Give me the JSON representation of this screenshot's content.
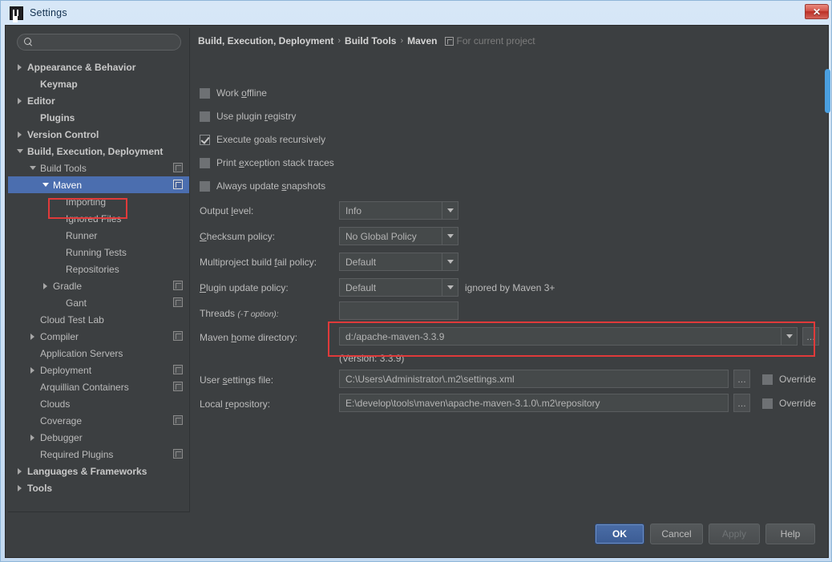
{
  "window": {
    "title": "Settings",
    "logo_icon": "intellij-idea-logo",
    "close_icon": "close-icon",
    "close_label": "✕"
  },
  "sidebar": {
    "search": {
      "value": "",
      "placeholder": "",
      "icon": "search-icon"
    },
    "items": [
      {
        "label": "Appearance & Behavior",
        "indent": 0,
        "arrow": "right",
        "bold": true,
        "selected": false,
        "module_icon": false
      },
      {
        "label": "Keymap",
        "indent": 1,
        "arrow": "none",
        "bold": true,
        "selected": false,
        "module_icon": false
      },
      {
        "label": "Editor",
        "indent": 0,
        "arrow": "right",
        "bold": true,
        "selected": false,
        "module_icon": false
      },
      {
        "label": "Plugins",
        "indent": 1,
        "arrow": "none",
        "bold": true,
        "selected": false,
        "module_icon": false
      },
      {
        "label": "Version Control",
        "indent": 0,
        "arrow": "right",
        "bold": true,
        "selected": false,
        "module_icon": false
      },
      {
        "label": "Build, Execution, Deployment",
        "indent": 0,
        "arrow": "down",
        "bold": true,
        "selected": false,
        "module_icon": false
      },
      {
        "label": "Build Tools",
        "indent": 1,
        "arrow": "down",
        "bold": false,
        "selected": false,
        "module_icon": true
      },
      {
        "label": "Maven",
        "indent": 2,
        "arrow": "down",
        "bold": false,
        "selected": true,
        "module_icon": true
      },
      {
        "label": "Importing",
        "indent": 3,
        "arrow": "none",
        "bold": false,
        "selected": false,
        "module_icon": false
      },
      {
        "label": "Ignored Files",
        "indent": 3,
        "arrow": "none",
        "bold": false,
        "selected": false,
        "module_icon": false
      },
      {
        "label": "Runner",
        "indent": 3,
        "arrow": "none",
        "bold": false,
        "selected": false,
        "module_icon": false
      },
      {
        "label": "Running Tests",
        "indent": 3,
        "arrow": "none",
        "bold": false,
        "selected": false,
        "module_icon": false
      },
      {
        "label": "Repositories",
        "indent": 3,
        "arrow": "none",
        "bold": false,
        "selected": false,
        "module_icon": false
      },
      {
        "label": "Gradle",
        "indent": 2,
        "arrow": "right",
        "bold": false,
        "selected": false,
        "module_icon": true
      },
      {
        "label": "Gant",
        "indent": 3,
        "arrow": "none",
        "bold": false,
        "selected": false,
        "module_icon": true
      },
      {
        "label": "Cloud Test Lab",
        "indent": 1,
        "arrow": "none",
        "bold": false,
        "selected": false,
        "module_icon": false
      },
      {
        "label": "Compiler",
        "indent": 1,
        "arrow": "right",
        "bold": false,
        "selected": false,
        "module_icon": true
      },
      {
        "label": "Application Servers",
        "indent": 1,
        "arrow": "none",
        "bold": false,
        "selected": false,
        "module_icon": false
      },
      {
        "label": "Deployment",
        "indent": 1,
        "arrow": "right",
        "bold": false,
        "selected": false,
        "module_icon": true
      },
      {
        "label": "Arquillian Containers",
        "indent": 1,
        "arrow": "none",
        "bold": false,
        "selected": false,
        "module_icon": true
      },
      {
        "label": "Clouds",
        "indent": 1,
        "arrow": "none",
        "bold": false,
        "selected": false,
        "module_icon": false
      },
      {
        "label": "Coverage",
        "indent": 1,
        "arrow": "none",
        "bold": false,
        "selected": false,
        "module_icon": true
      },
      {
        "label": "Debugger",
        "indent": 1,
        "arrow": "right",
        "bold": false,
        "selected": false,
        "module_icon": false
      },
      {
        "label": "Required Plugins",
        "indent": 1,
        "arrow": "none",
        "bold": false,
        "selected": false,
        "module_icon": true
      },
      {
        "label": "Languages & Frameworks",
        "indent": 0,
        "arrow": "right",
        "bold": true,
        "selected": false,
        "module_icon": false
      },
      {
        "label": "Tools",
        "indent": 0,
        "arrow": "right",
        "bold": true,
        "selected": false,
        "module_icon": false
      }
    ]
  },
  "breadcrumb": {
    "part1": "Build, Execution, Deployment",
    "part2": "Build Tools",
    "part3": "Maven",
    "separator": "›",
    "scope_icon": "module-scope-icon",
    "scope_label": "For current project"
  },
  "checkboxes": [
    {
      "label_pre": "Work ",
      "mnemonic": "o",
      "label_post": "ffline",
      "checked": false
    },
    {
      "label_pre": "Use plugin ",
      "mnemonic": "r",
      "label_post": "egistry",
      "checked": false
    },
    {
      "label_pre": "Execute ",
      "mnemonic": "g",
      "label_post": "oals recursively",
      "checked": true
    },
    {
      "label_pre": "Print ",
      "mnemonic": "e",
      "label_post": "xception stack traces",
      "checked": false
    },
    {
      "label_pre": "Always update ",
      "mnemonic": "s",
      "label_post": "napshots",
      "checked": false
    }
  ],
  "fields": {
    "output_level": {
      "label_pre": "Output ",
      "mnemonic": "l",
      "label_post": "evel:",
      "value": "Info"
    },
    "checksum_policy": {
      "label_pre": "",
      "mnemonic": "C",
      "label_post": "hecksum policy:",
      "value": "No Global Policy"
    },
    "multiproject": {
      "label_pre": "Multiproject build ",
      "mnemonic": "f",
      "label_post": "ail policy:",
      "value": "Default"
    },
    "plugin_update": {
      "label_pre": "",
      "mnemonic": "P",
      "label_post": "lugin update policy:",
      "value": "Default",
      "note": "ignored by Maven 3+"
    },
    "threads": {
      "label": "Threads",
      "hint": "(-T option):",
      "value": ""
    },
    "maven_home": {
      "label_pre": "Maven ",
      "mnemonic": "h",
      "label_post": "ome directory:",
      "value": "d:/apache-maven-3.3.9",
      "version_note": "(Version: 3.3.9)",
      "browse_label": "…"
    },
    "user_settings": {
      "label_pre": "User ",
      "mnemonic": "s",
      "label_post": "ettings file:",
      "value": "C:\\Users\\Administrator\\.m2\\settings.xml",
      "browse_label": "…",
      "override_label": "Override",
      "override_checked": false
    },
    "local_repo": {
      "label_pre": "Local ",
      "mnemonic": "r",
      "label_post": "epository:",
      "value": "E:\\develop\\tools\\maven\\apache-maven-3.1.0\\.m2\\repository",
      "browse_label": "…",
      "override_label": "Override",
      "override_checked": false
    }
  },
  "buttons": {
    "ok": "OK",
    "cancel": "Cancel",
    "apply": "Apply",
    "help": "Help"
  },
  "colors": {
    "accent_selection": "#4b6eaf",
    "annotation": "#e03a3a",
    "panel_bg": "#3c3f41",
    "scrollbar": "#4a9fe0"
  }
}
